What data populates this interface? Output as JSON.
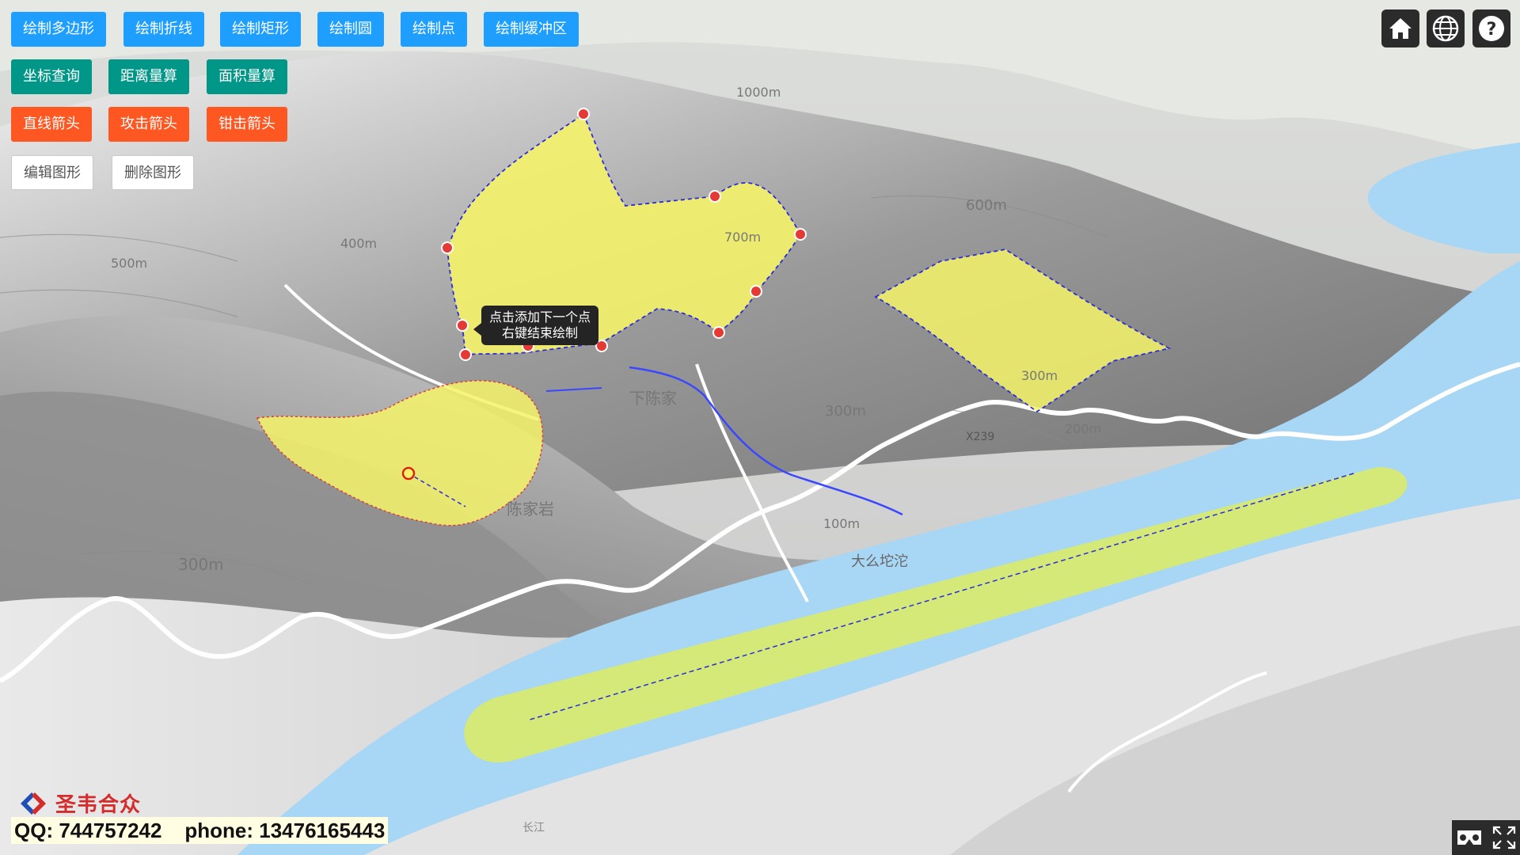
{
  "toolbar": {
    "row1": [
      "绘制多边形",
      "绘制折线",
      "绘制矩形",
      "绘制圆",
      "绘制点",
      "绘制缓冲区"
    ],
    "row2": [
      "坐标查询",
      "距离量算",
      "面积量算"
    ],
    "row3": [
      "直线箭头",
      "攻击箭头",
      "钳击箭头"
    ],
    "row4": [
      "编辑图形",
      "删除图形"
    ]
  },
  "tooltip": {
    "line1": "点击添加下一个点",
    "line2": "右键结束绘制"
  },
  "map_labels": {
    "m1000": "1000m",
    "m600": "600m",
    "m400": "400m",
    "m500": "500m",
    "m300a": "300m",
    "m300b": "300m",
    "m300c": "300m",
    "m200": "200m",
    "m100": "100m",
    "m700": "700m",
    "road": "X239",
    "place1": "大么坨沱",
    "place2": "下陈家",
    "place3": "陈家岩",
    "place4": "长江"
  },
  "logo": {
    "text": "圣韦合众"
  },
  "contact": {
    "text": "QQ: 744757242    phone: 13476165443"
  },
  "icons": {
    "home": "home-icon",
    "globe": "globe-icon",
    "help": "help-icon",
    "vr": "vr-icon",
    "fullscreen": "fullscreen-icon"
  },
  "colors": {
    "blue": "#1e9fff",
    "teal": "#009688",
    "orange": "#ff5722",
    "polygon": "#f4f36a",
    "buffer": "#d7ea72",
    "water": "#a8d6f5"
  }
}
